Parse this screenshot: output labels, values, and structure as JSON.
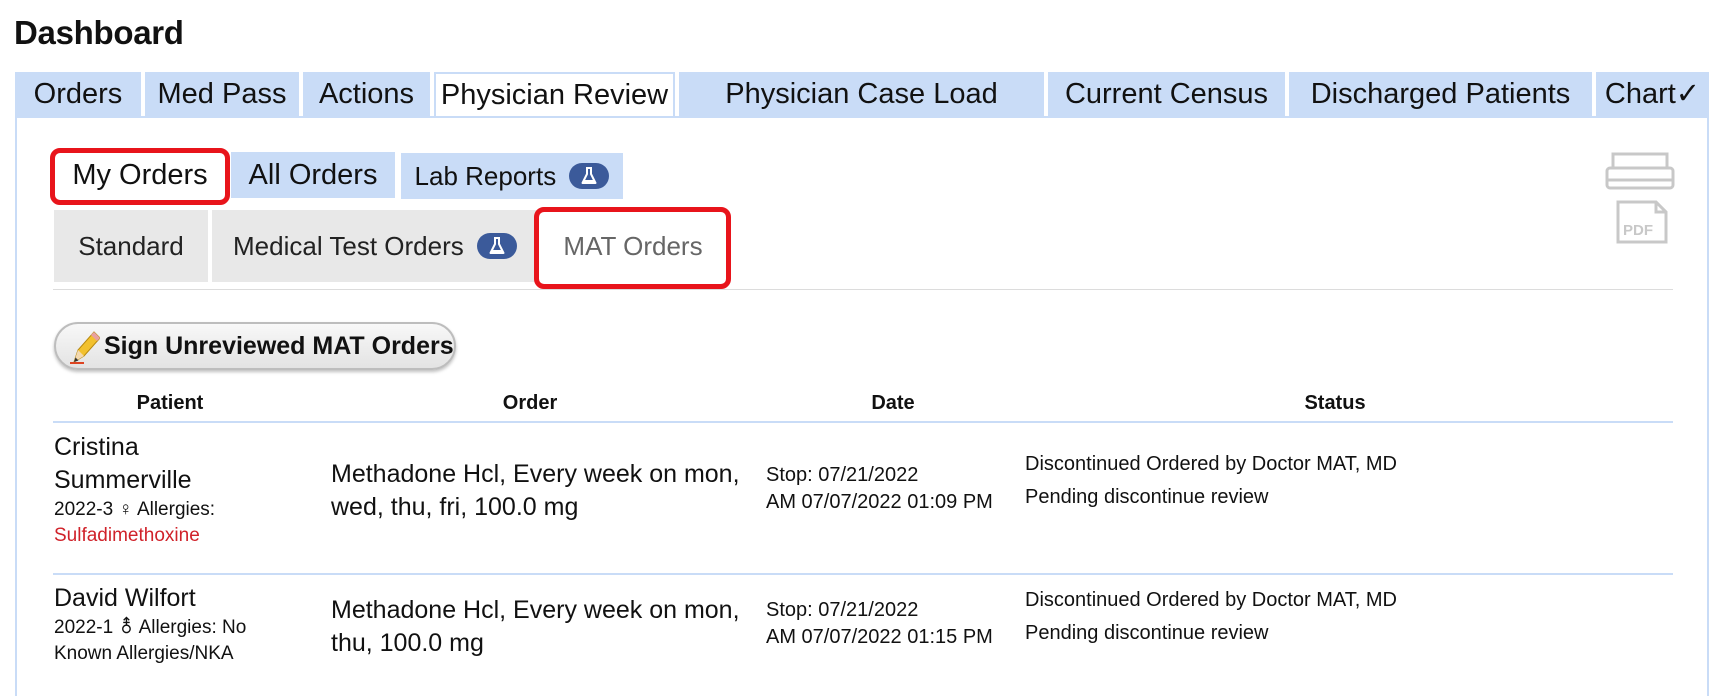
{
  "page": {
    "title": "Dashboard"
  },
  "top_tabs": [
    {
      "label": "Orders"
    },
    {
      "label": "Med Pass"
    },
    {
      "label": "Actions"
    },
    {
      "label": "Physician Review",
      "active": true
    },
    {
      "label": "Physician Case Load"
    },
    {
      "label": "Current Census"
    },
    {
      "label": "Discharged Patients"
    },
    {
      "label": "Chart✓"
    }
  ],
  "sub_tabs": {
    "my_orders": "My Orders",
    "all_orders": "All Orders",
    "lab_reports": "Lab Reports"
  },
  "category_tabs": {
    "standard": "Standard",
    "medical_test_orders": "Medical Test Orders",
    "mat_orders": "MAT Orders"
  },
  "toolbar": {
    "pdf_label": "PDF"
  },
  "sign_button": {
    "label": "Sign Unreviewed MAT Orders"
  },
  "table": {
    "headers": {
      "patient": "Patient",
      "order": "Order",
      "date": "Date",
      "status": "Status"
    },
    "rows": [
      {
        "patient_name_line1": "Cristina",
        "patient_name_line2": "Summerville",
        "patient_id": "2022-3",
        "sex_symbol": "♀",
        "allergies_label": "Allergies:",
        "allergies_value": "Sulfadimethoxine",
        "order_line1": "Methadone Hcl, Every week on mon,",
        "order_line2": "wed, thu, fri, 100.0 mg",
        "date_line1": "Stop: 07/21/2022",
        "date_line2": "AM 07/07/2022 01:09 PM",
        "status_line1": "Discontinued Ordered by Doctor MAT, MD",
        "status_line2": "Pending discontinue review"
      },
      {
        "patient_name_line1": "David Wilfort",
        "patient_id": "2022-1",
        "sex_symbol": "⚨",
        "allergies_label": "Allergies: No",
        "allergies_value": "Known Allergies/NKA",
        "order_line1": "Methadone Hcl, Every week on mon,",
        "order_line2": "thu, 100.0 mg",
        "date_line1": "Stop: 07/21/2022",
        "date_line2": "AM 07/07/2022 01:15 PM",
        "status_line1": "Discontinued Ordered by Doctor MAT, MD",
        "status_line2": "Pending discontinue review"
      }
    ]
  },
  "colors": {
    "tab_blue": "#c9dcf7",
    "highlight_red": "#e8141b",
    "badge_blue": "#3b5a9a",
    "allergy_red": "#d0222a"
  }
}
